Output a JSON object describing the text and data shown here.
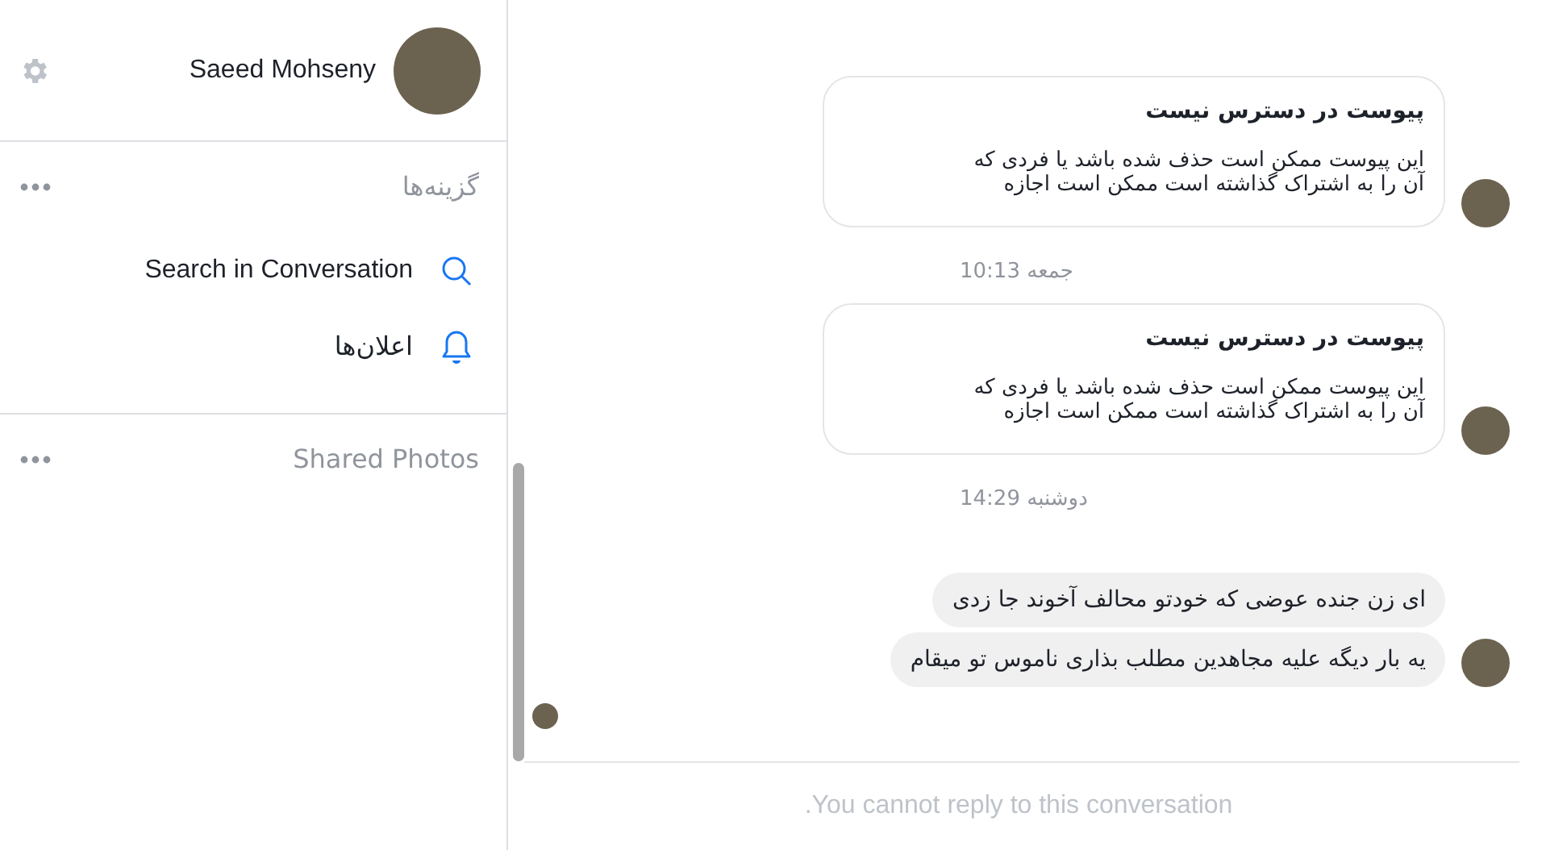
{
  "profile": {
    "name": "Saeed Mohseny"
  },
  "sections": [
    {
      "title": "گزینه‌ها",
      "items": [
        {
          "kind": "search",
          "label": "Search in Conversation"
        },
        {
          "kind": "notifications",
          "label": "اعلان‌ها"
        }
      ]
    },
    {
      "title": "Shared Photos"
    }
  ],
  "messages": [
    {
      "kind": "attachment",
      "title": "پیوست در دسترس نیست",
      "body": "این پیوست ممکن است حذف شده باشد یا فردی که\nآن را به اشتراک گذاشته است ممکن است اجازه",
      "show_avatar": true
    },
    {
      "kind": "timestamp",
      "text": "جمعه 10:13"
    },
    {
      "kind": "attachment",
      "title": "پیوست در دسترس نیست",
      "body": "این پیوست ممکن است حذف شده باشد یا فردی که\nآن را به اشتراک گذاشته است ممکن است اجازه",
      "show_avatar": true
    },
    {
      "kind": "timestamp",
      "text": "دوشنبه 14:29"
    },
    {
      "kind": "text",
      "text": "ای زن جنده عوضی که خودتو محالف آخوند جا زدی",
      "show_avatar": false
    },
    {
      "kind": "text",
      "text": "یه بار دیگه علیه مجاهدین مطلب بذاری ناموس تو میقام",
      "show_avatar": true
    }
  ],
  "seen": true,
  "footer": {
    "text": ".You cannot reply to this conversation"
  }
}
